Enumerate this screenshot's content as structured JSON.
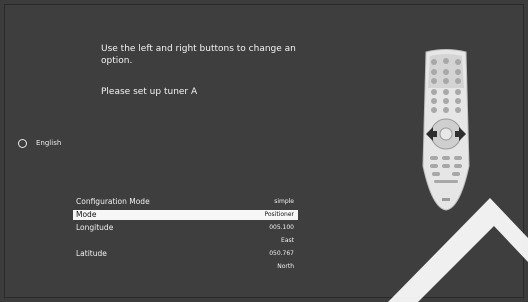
{
  "instructions": {
    "line1": "Use the left and right buttons to change an option.",
    "line2": "Please set up tuner A"
  },
  "language": {
    "label": "English",
    "selected": false
  },
  "settings": {
    "rows": [
      {
        "label": "Configuration Mode",
        "value": "simple",
        "selected": false
      },
      {
        "label": "Mode",
        "value": "Positioner",
        "selected": true
      },
      {
        "label": "Longitude",
        "value": "005.100",
        "selected": false
      },
      {
        "label": "",
        "value": "East",
        "selected": false
      },
      {
        "label": "Latitude",
        "value": "050.767",
        "selected": false
      },
      {
        "label": "",
        "value": "North",
        "selected": false
      }
    ]
  },
  "remote": {
    "icon": "remote-control-icon",
    "arrows": [
      "left-arrow-icon",
      "right-arrow-icon"
    ]
  },
  "colors": {
    "background": "#3e3e3e",
    "text": "#f2f2f2",
    "selected_row": "#f7f7f7"
  }
}
